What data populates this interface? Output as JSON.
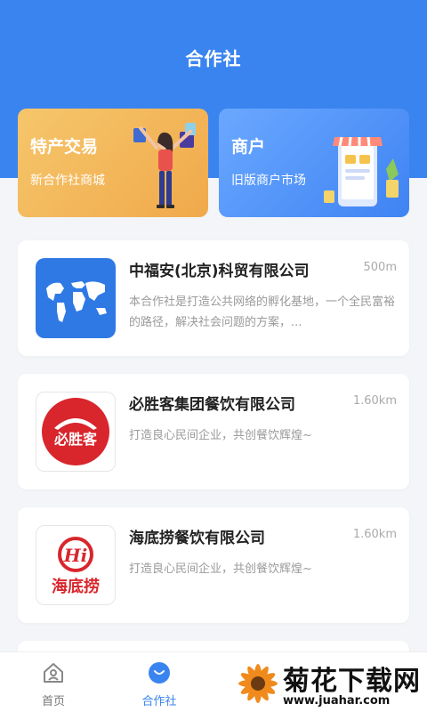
{
  "header": {
    "title": "合作社"
  },
  "top_cards": [
    {
      "title": "特产交易",
      "subtitle": "新合作社商城"
    },
    {
      "title": "商户",
      "subtitle": "旧版商户市场"
    }
  ],
  "cooperatives": [
    {
      "name": "中福安(北京)科贸有限公司",
      "distance": "500m",
      "description": "本合作社是打造公共网络的孵化基地，一个全民富裕的路径，解决社会问题的方案，..."
    },
    {
      "name": "必胜客集团餐饮有限公司",
      "distance": "1.60km",
      "description": "打造良心民间企业，共创餐饮辉煌~",
      "logo_text": "必胜客"
    },
    {
      "name": "海底捞餐饮有限公司",
      "distance": "1.60km",
      "description": "打造良心民间企业，共创餐饮辉煌~",
      "logo_text": "海底捞",
      "logo_mark": "Hi"
    }
  ],
  "tabbar": {
    "items": [
      {
        "label": "首页",
        "icon": "home-icon"
      },
      {
        "label": "合作社",
        "icon": "cooperative-icon",
        "active": true
      }
    ]
  },
  "watermark": {
    "text": "菊花下载网",
    "url": "www.juahar.com"
  },
  "colors": {
    "primary": "#3a84ef",
    "orange": "#f0a94b",
    "red": "#d8262c"
  }
}
